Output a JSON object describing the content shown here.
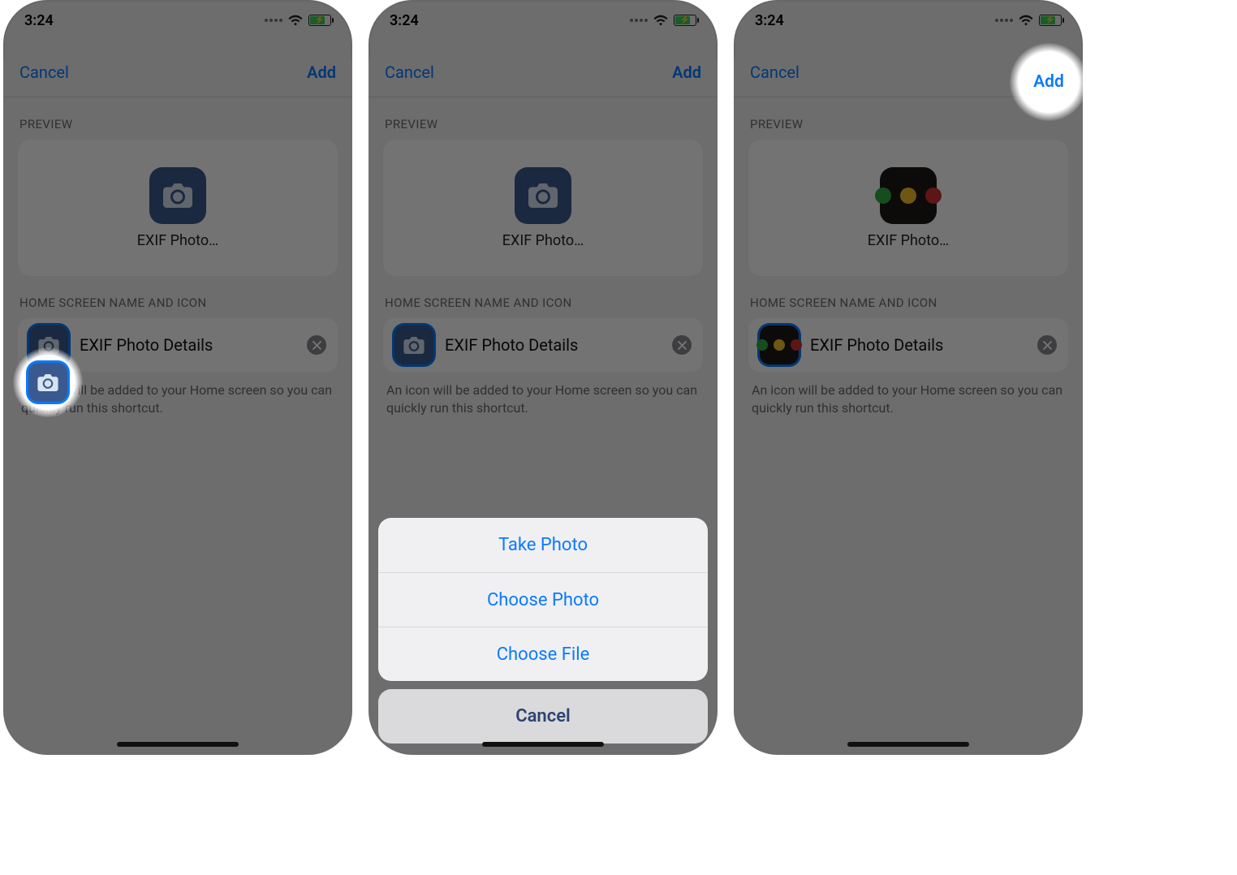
{
  "status": {
    "time": "3:24"
  },
  "nav": {
    "cancel": "Cancel",
    "add": "Add"
  },
  "sections": {
    "preview": "PREVIEW",
    "home_name_icon": "HOME SCREEN NAME AND ICON"
  },
  "preview": {
    "app_label": "EXIF Photo…"
  },
  "name_row": {
    "shortcut_name": "EXIF Photo Details"
  },
  "helper_text": "An icon will be added to your Home screen so you can quickly run this shortcut.",
  "action_sheet": {
    "take_photo": "Take Photo",
    "choose_photo": "Choose Photo",
    "choose_file": "Choose File",
    "cancel": "Cancel"
  },
  "icons": {
    "camera": "camera-icon",
    "wifi": "wifi-icon",
    "battery": "battery-icon",
    "clear": "clear-icon",
    "traffic": "traffic-light-icon"
  }
}
